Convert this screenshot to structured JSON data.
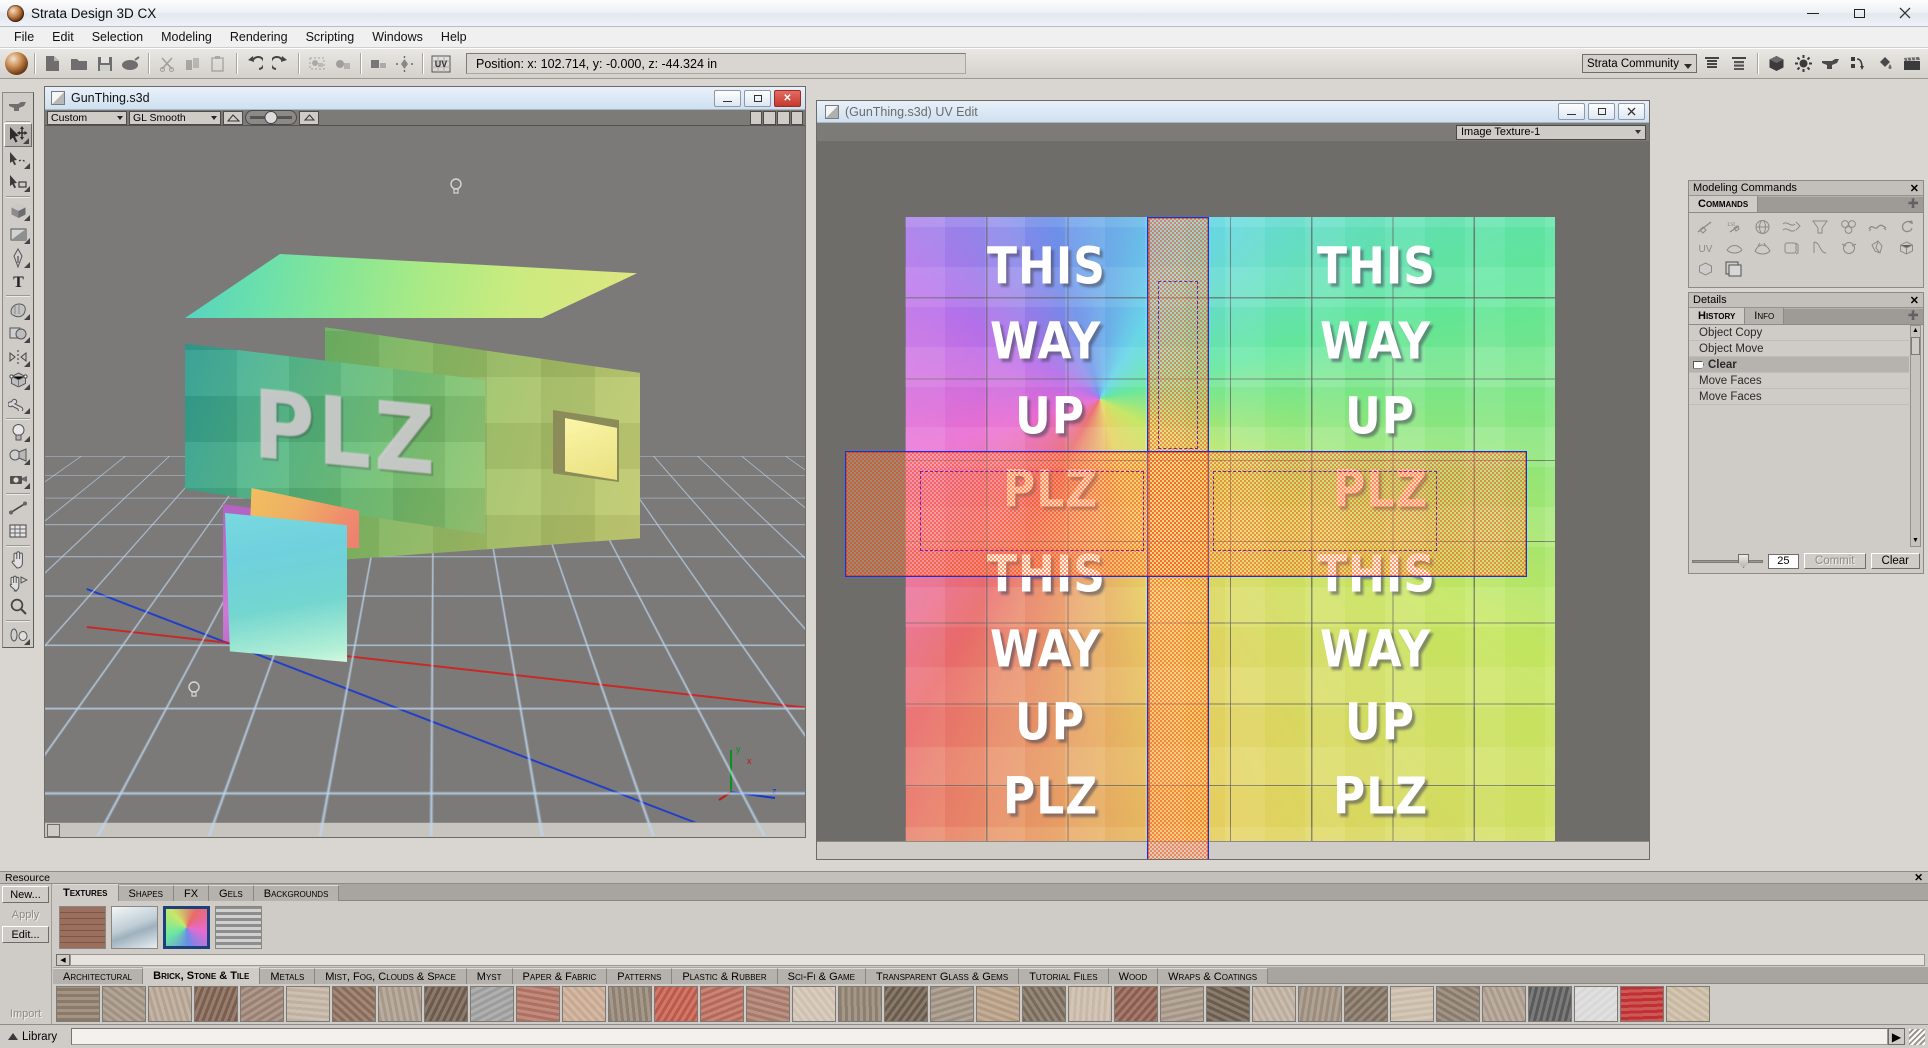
{
  "window": {
    "title": "Strata Design 3D CX",
    "app_icon": "strata-sphere-icon",
    "minimize": "—",
    "maximize": "❐",
    "close": "✕"
  },
  "menubar": {
    "items": [
      "File",
      "Edit",
      "Selection",
      "Modeling",
      "Rendering",
      "Scripting",
      "Windows",
      "Help"
    ]
  },
  "toolbar": {
    "position_readout": "Position:  x: 102.714,  y: -0.000,  z: -44.324 in",
    "community_dropdown": "Strata Community",
    "buttons": [
      {
        "name": "new-document-button",
        "icon": "page-icon"
      },
      {
        "name": "open-folder-button",
        "icon": "folder-icon"
      },
      {
        "name": "save-button",
        "icon": "floppy-disk-icon"
      },
      {
        "name": "render-button",
        "icon": "render-icon"
      },
      {
        "name": "cut-button",
        "icon": "scissors-icon"
      },
      {
        "name": "copy-button",
        "icon": "copy-icon"
      },
      {
        "name": "paste-button",
        "icon": "clipboard-icon"
      },
      {
        "name": "undo-button",
        "icon": "undo-arrow-icon"
      },
      {
        "name": "redo-button",
        "icon": "redo-arrow-icon"
      },
      {
        "name": "group-button",
        "icon": "group-icon"
      },
      {
        "name": "ungroup-button",
        "icon": "ungroup-icon"
      },
      {
        "name": "align-button",
        "icon": "align-icon"
      },
      {
        "name": "distribute-button",
        "icon": "distribute-icon"
      },
      {
        "name": "uv-button",
        "icon": "uv-icon"
      }
    ],
    "right_buttons": [
      {
        "name": "align-left-button",
        "icon": "align-lines-icon"
      },
      {
        "name": "list-button",
        "icon": "list-icon"
      },
      {
        "name": "model-button",
        "icon": "cube-icon"
      },
      {
        "name": "environment-button",
        "icon": "sun-icon"
      },
      {
        "name": "anvil-button",
        "icon": "anvil-icon"
      },
      {
        "name": "animation-button",
        "icon": "keyframe-icon"
      },
      {
        "name": "paint-button",
        "icon": "paint-bucket-icon"
      },
      {
        "name": "film-button",
        "icon": "film-clapper-icon"
      }
    ]
  },
  "left_tools": [
    {
      "name": "tool-anvil",
      "icon": "anvil-icon",
      "selected": false
    },
    {
      "name": "tool-select-move",
      "icon": "arrow-move-icon",
      "selected": true
    },
    {
      "name": "tool-lasso-select",
      "icon": "arrow-lasso-icon",
      "selected": false
    },
    {
      "name": "tool-object-select",
      "icon": "arrow-object-icon",
      "selected": false
    },
    {
      "name": "tool-cube-primitive",
      "icon": "cube-icon",
      "selected": false
    },
    {
      "name": "tool-plane-primitive",
      "icon": "plane-icon",
      "selected": false
    },
    {
      "name": "tool-pen",
      "icon": "pen-nib-icon",
      "selected": false
    },
    {
      "name": "tool-text",
      "icon": "text-t-icon",
      "selected": false
    },
    {
      "name": "tool-sculpt",
      "icon": "sculpt-hand-icon",
      "selected": false
    },
    {
      "name": "tool-boolean",
      "icon": "boolean-shapes-icon",
      "selected": false
    },
    {
      "name": "tool-mirror",
      "icon": "mirror-icon",
      "selected": false
    },
    {
      "name": "tool-deform-cage",
      "icon": "deform-cube-icon",
      "selected": false
    },
    {
      "name": "tool-bone",
      "icon": "bone-icon",
      "selected": false
    },
    {
      "name": "tool-light",
      "icon": "light-bulb-icon",
      "selected": false
    },
    {
      "name": "tool-spotlight",
      "icon": "spotlight-icon",
      "selected": false
    },
    {
      "name": "tool-camera",
      "icon": "camera-icon",
      "selected": false
    },
    {
      "name": "tool-measure",
      "icon": "measure-icon",
      "selected": false
    },
    {
      "name": "tool-grid",
      "icon": "grid-icon",
      "selected": false
    },
    {
      "name": "tool-pan",
      "icon": "hand-pan-icon",
      "selected": false
    },
    {
      "name": "tool-rotate-view",
      "icon": "hand-rotate-icon",
      "selected": false
    },
    {
      "name": "tool-zoom",
      "icon": "magnifier-icon",
      "selected": false
    },
    {
      "name": "tool-lathe",
      "icon": "lathe-icon",
      "selected": false
    }
  ],
  "viewport": {
    "title": "GunThing.s3d",
    "icon": "document-3d-icon",
    "minimize": "—",
    "maximize": "□",
    "close": "✕",
    "view_preset": "Custom",
    "shading_mode": "GL Smooth",
    "object_text": "PLZ",
    "gizmo_labels": [
      "x",
      "y",
      "z"
    ]
  },
  "uv_editor": {
    "title": "(GunThing.s3d) UV Edit",
    "icon": "document-3d-icon",
    "minimize": "—",
    "maximize": "□",
    "close": "✕",
    "texture_dropdown": "Image Texture-1",
    "texture_words_left": [
      "THIS",
      "WAY",
      "UP",
      "PLZ"
    ],
    "texture_words_right": [
      "THIS",
      "WAY",
      "UP",
      "PLZ"
    ],
    "selection_color": "#ff5a1e",
    "selection_outline": "#1f2fd8"
  },
  "modeling_commands": {
    "panel_title": "Modeling Commands",
    "close_glyph": "✕",
    "tab": "Commands",
    "add_glyph": "➕",
    "icons": [
      "extrude-path-icon",
      "first-point-icon",
      "sphere-wire-icon",
      "skin-surface-icon",
      "cone-deform-icon",
      "metaball-icon",
      "path-flow-icon",
      "sweep-icon",
      "uv-map-icon",
      "cloth-icon",
      "inflate-icon",
      "solidify-icon",
      "bend-icon",
      "sphere-morph-icon",
      "shatter-icon",
      "cube-shrink-icon",
      "cube-smooth-icon",
      "duplicate-layers-icon"
    ]
  },
  "details": {
    "panel_title": "Details",
    "close_glyph": "✕",
    "tabs": [
      {
        "label": "History",
        "active": true
      },
      {
        "label": "Info",
        "active": false
      }
    ],
    "add_glyph": "➕",
    "history": [
      {
        "label": "Object Copy",
        "selected": false
      },
      {
        "label": "Object Move",
        "selected": false
      },
      {
        "label": "Clear",
        "selected": true
      },
      {
        "label": "Move Faces",
        "selected": false
      },
      {
        "label": "Move Faces",
        "selected": false
      }
    ],
    "slider_value": "25",
    "commit_label": "Commit",
    "clear_label": "Clear",
    "scroll_up_glyph": "▲",
    "scroll_down_glyph": "▼"
  },
  "resource": {
    "bar_title": "Resource",
    "close_glyph": "✕",
    "buttons": [
      {
        "label": "New...",
        "name": "new-resource-button",
        "enabled": true
      },
      {
        "label": "Apply",
        "name": "apply-resource-button",
        "enabled": false
      },
      {
        "label": "Edit...",
        "name": "edit-resource-button",
        "enabled": true
      },
      {
        "label": "Import",
        "name": "import-resource-button",
        "enabled": false
      }
    ],
    "type_tabs": [
      {
        "label": "Textures",
        "active": true
      },
      {
        "label": "Shapes",
        "active": false
      },
      {
        "label": "FX",
        "active": false
      },
      {
        "label": "Gels",
        "active": false
      },
      {
        "label": "Backgrounds",
        "active": false
      }
    ],
    "swatches": [
      {
        "name": "swatch-brick",
        "selected": false,
        "color": "#a8796a"
      },
      {
        "name": "swatch-glass",
        "selected": false,
        "color": "#cfd8dc"
      },
      {
        "name": "swatch-rainbow-texture",
        "selected": true,
        "color": "#9ad06a"
      },
      {
        "name": "swatch-metal-lines",
        "selected": false,
        "color": "#9a9a9a"
      }
    ],
    "category_tabs": [
      {
        "label": "Architectural",
        "active": false
      },
      {
        "label": "Brick, Stone & Tile",
        "active": true
      },
      {
        "label": "Metals",
        "active": false
      },
      {
        "label": "Mist, Fog, Clouds & Space",
        "active": false
      },
      {
        "label": "Myst",
        "active": false
      },
      {
        "label": "Paper & Fabric",
        "active": false
      },
      {
        "label": "Patterns",
        "active": false
      },
      {
        "label": "Plastic & Rubber",
        "active": false
      },
      {
        "label": "Sci-Fi & Game",
        "active": false
      },
      {
        "label": "Transparent Glass & Gems",
        "active": false
      },
      {
        "label": "Tutorial Files",
        "active": false
      },
      {
        "label": "Wood",
        "active": false
      },
      {
        "label": "Wraps & Coatings",
        "active": false
      }
    ],
    "thumbnail_colors": [
      "#8c7a68",
      "#a09080",
      "#b4a290",
      "#7c5e4c",
      "#9a8070",
      "#c0b0a0",
      "#8a6a58",
      "#a89888",
      "#6e5a4a",
      "#9c9c9c",
      "#b07060",
      "#c8a890",
      "#8f7f6f",
      "#c05848",
      "#b86858",
      "#a87868",
      "#d0c0b0",
      "#8e7e6e",
      "#6a5a4a",
      "#9e8e7e",
      "#b49a80",
      "#7a6a5a",
      "#c8b8a8",
      "#8c5c4c",
      "#a49484",
      "#6c5c4c",
      "#bcac9c",
      "#9c8c7c",
      "#7e6e5e",
      "#cabaa8",
      "#8a7a6a",
      "#aa9a8a",
      "#5a5a5a",
      "#d8d8d8",
      "#c03030",
      "#c8b8a0"
    ]
  },
  "statusbar": {
    "library_label": "Library",
    "library_icon": "triangle-up-icon",
    "expand_glyph": "▶"
  }
}
